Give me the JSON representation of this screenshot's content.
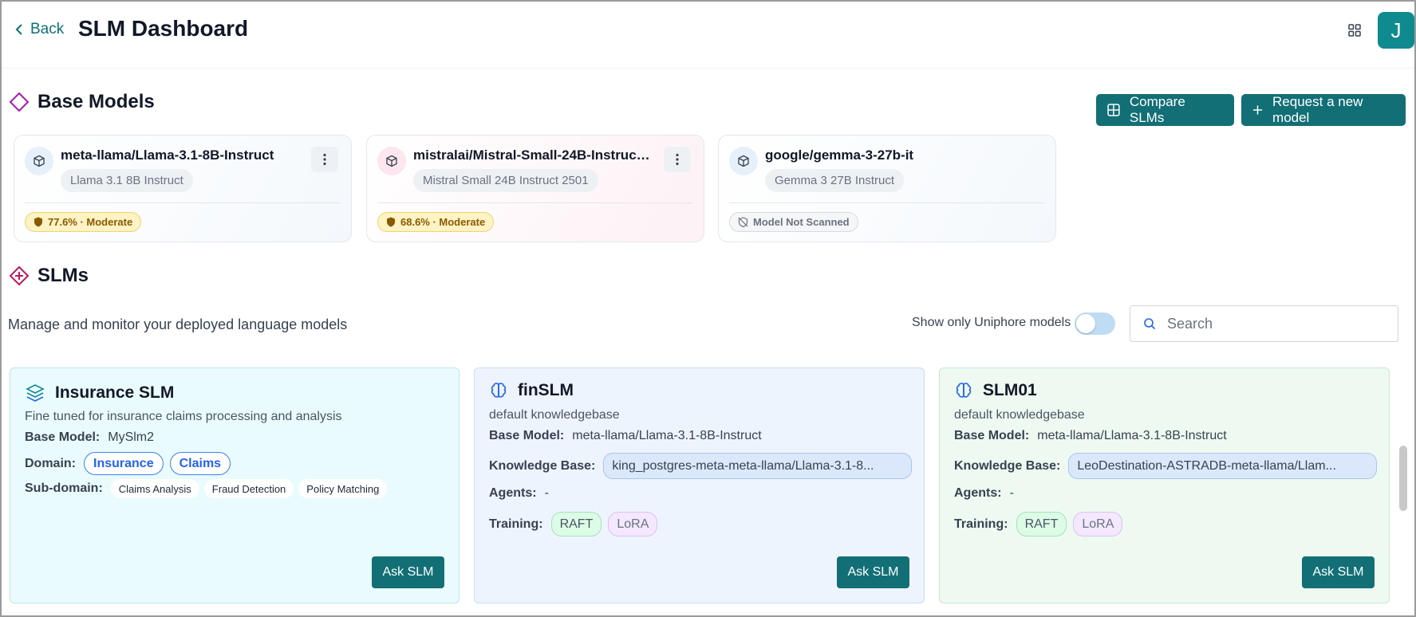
{
  "header": {
    "back_label": "Back",
    "title": "SLM Dashboard",
    "avatar_initial": "J"
  },
  "base_models": {
    "title": "Base Models",
    "compare_label": "Compare SLMs",
    "request_label": "Request a new model",
    "cards": [
      {
        "name": "meta-llama/Llama-3.1-8B-Instruct",
        "display": "Llama 3.1 8B Instruct",
        "score": "77.6% · Moderate",
        "scanned": true
      },
      {
        "name": "mistralai/Mistral-Small-24B-Instruct-2...",
        "display": "Mistral Small 24B Instruct 2501",
        "score": "68.6% · Moderate",
        "scanned": true
      },
      {
        "name": "google/gemma-3-27b-it",
        "display": "Gemma 3 27B Instruct",
        "score": "Model Not Scanned",
        "scanned": false
      }
    ]
  },
  "slms": {
    "title": "SLMs",
    "description": "Manage and monitor your deployed language models",
    "toggle_label": "Show only Uniphore models",
    "toggle_on": false,
    "search_placeholder": "Search",
    "cards": [
      {
        "name": "Insurance SLM",
        "description": "Fine tuned for insurance claims processing and analysis",
        "base_model_label": "Base Model:",
        "base_model": "MySlm2",
        "domain_label": "Domain:",
        "domains": [
          "Insurance",
          "Claims"
        ],
        "subdomain_label": "Sub-domain:",
        "subdomains": [
          "Claims Analysis",
          "Fraud Detection",
          "Policy Matching"
        ],
        "ask_label": "Ask SLM"
      },
      {
        "name": "finSLM",
        "description": "default knowledgebase",
        "base_model_label": "Base Model:",
        "base_model": "meta-llama/Llama-3.1-8B-Instruct",
        "kb_label": "Knowledge Base:",
        "kb": "king_postgres-meta-meta-llama/Llama-3.1-8...",
        "agents_label": "Agents:",
        "agents": "-",
        "training_label": "Training:",
        "training": [
          "RAFT",
          "LoRA"
        ],
        "ask_label": "Ask SLM"
      },
      {
        "name": "SLM01",
        "description": "default knowledgebase",
        "base_model_label": "Base Model:",
        "base_model": "meta-llama/Llama-3.1-8B-Instruct",
        "kb_label": "Knowledge Base:",
        "kb": "LeoDestination-ASTRADB-meta-llama/Llam...",
        "agents_label": "Agents:",
        "agents": "-",
        "training_label": "Training:",
        "training": [
          "RAFT",
          "LoRA"
        ],
        "ask_label": "Ask SLM"
      }
    ]
  },
  "colors": {
    "accent": "#126f75",
    "risk_badge_bg": "#fdf3c4",
    "domain_chip": "#2563eb"
  }
}
